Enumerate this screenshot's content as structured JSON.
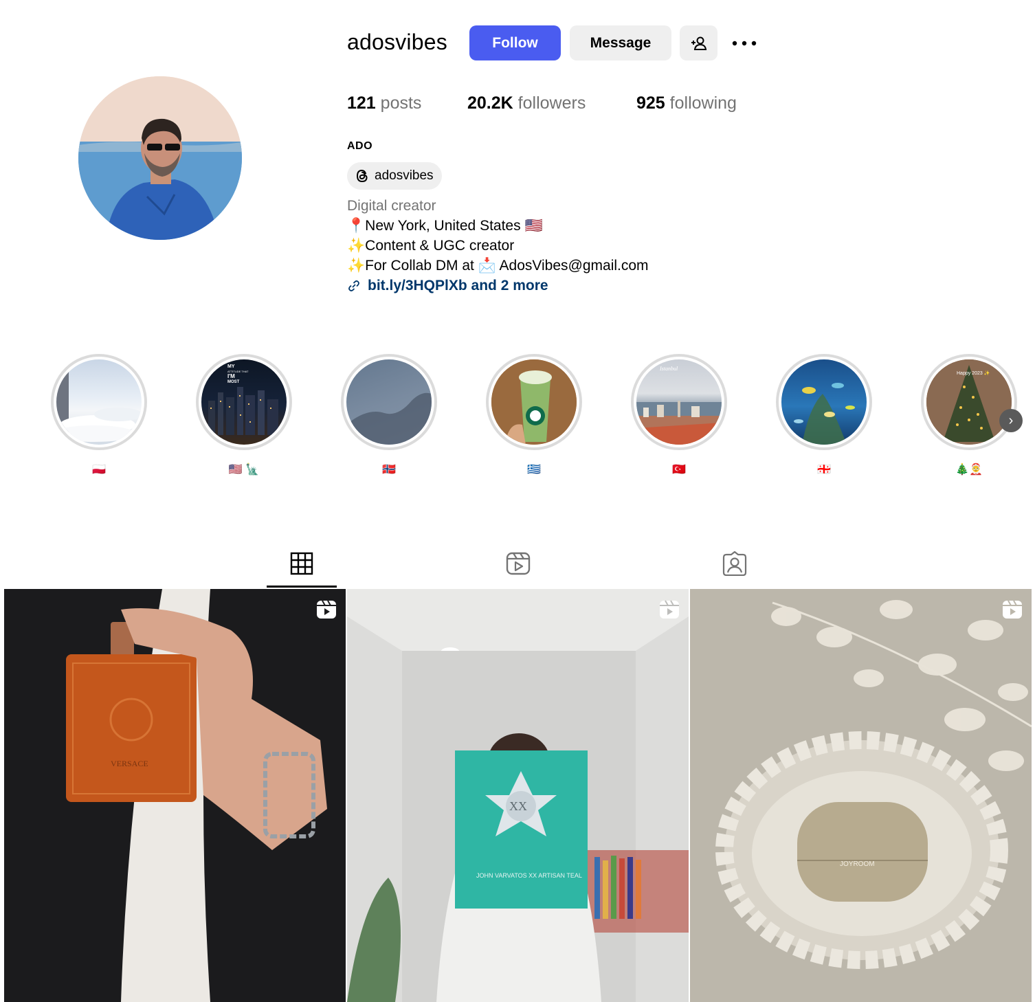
{
  "profile": {
    "username": "adosvibes",
    "follow_label": "Follow",
    "message_label": "Message",
    "stats": {
      "posts_count": "121",
      "posts_label": "posts",
      "followers_count": "20.2K",
      "followers_label": "followers",
      "following_count": "925",
      "following_label": "following"
    },
    "full_name": "ADO",
    "threads_handle": "adosvibes",
    "category": "Digital creator",
    "bio_lines": [
      "📍New York, United States 🇺🇸",
      "✨Content & UGC creator",
      "✨For Collab DM at 📩 AdosVibes@gmail.com"
    ],
    "link_text": "bit.ly/3HQPlXb and 2 more"
  },
  "highlights": [
    {
      "label": "🇵🇱",
      "icon": "clouds"
    },
    {
      "label": "🇺🇸 🗽",
      "icon": "city-night",
      "overlay_text": "MY ATTITUDE THAT I'M MOST DEFINITELY"
    },
    {
      "label": "🇳🇴",
      "icon": "coast-aerial"
    },
    {
      "label": "🇬🇷",
      "icon": "green-drink"
    },
    {
      "label": "🇹🇷",
      "icon": "istanbul",
      "overlay_text": "Good morning Istanbul 🇹🇷"
    },
    {
      "label": "🇬🇪",
      "icon": "aquarium"
    },
    {
      "label": "🎄🤶",
      "icon": "christmas-tree",
      "overlay_text": "Happy 2023 ✨"
    }
  ],
  "tabs": [
    {
      "name": "posts",
      "icon": "grid-icon",
      "active": true
    },
    {
      "name": "reels",
      "icon": "reels-icon",
      "active": false
    },
    {
      "name": "tagged",
      "icon": "tagged-icon",
      "active": false
    }
  ],
  "posts": [
    {
      "type": "reel",
      "subject": "orange perfume bottle",
      "brand_text": "VERSACE"
    },
    {
      "type": "reel",
      "subject": "teal perfume box",
      "brand_text": "JOHN VARVATOS XX ARTISAN TEAL"
    },
    {
      "type": "reel",
      "subject": "earbuds case",
      "brand_text": "JOYROOM"
    }
  ],
  "colors": {
    "follow_blue": "#4a5cf0",
    "button_gray": "#efefef",
    "link_blue": "#00376b",
    "muted_text": "#737373",
    "highlight_ring": "#dbdbdb"
  }
}
